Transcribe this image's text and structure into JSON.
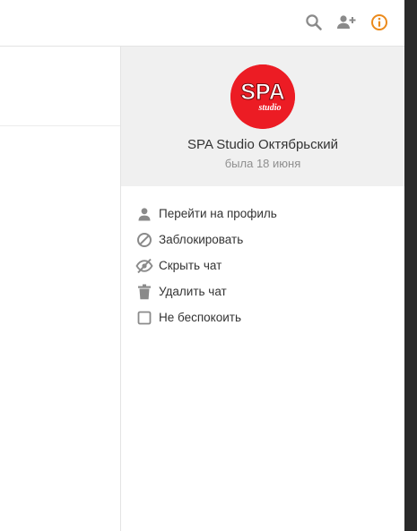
{
  "colors": {
    "accent": "#eb8a1c",
    "icon_gray": "#8a8a8a",
    "avatar_red": "#ec1c24"
  },
  "toolbar": {
    "search_icon": "search-icon",
    "add_user_icon": "add-user-icon",
    "info_icon": "info-icon"
  },
  "profile": {
    "avatar_text": "SPA",
    "avatar_subtext": "studio",
    "name": "SPA Studio Октябрьский",
    "status": "была 18 июня"
  },
  "menu": {
    "items": [
      {
        "label": "Перейти на профиль",
        "icon": "user-icon"
      },
      {
        "label": "Заблокировать",
        "icon": "block-icon"
      },
      {
        "label": "Скрыть чат",
        "icon": "eye-off-icon"
      },
      {
        "label": "Удалить чат",
        "icon": "trash-icon"
      },
      {
        "label": "Не беспокоить",
        "icon": "checkbox-icon"
      }
    ]
  }
}
